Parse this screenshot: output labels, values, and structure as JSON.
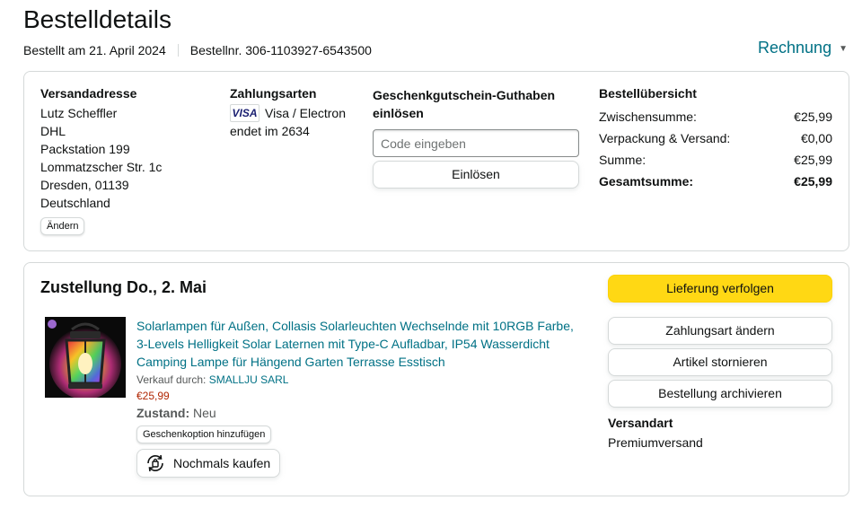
{
  "header": {
    "title": "Bestelldetails",
    "ordered_on": "Bestellt am 21. April 2024",
    "order_number": "Bestellnr. 306-1103927-6543500",
    "invoice_label": "Rechnung"
  },
  "address": {
    "title": "Versandadresse",
    "lines": [
      "Lutz Scheffler",
      "DHL",
      "Packstation 199",
      "Lommatzscher Str. 1c",
      "Dresden, 01139",
      "Deutschland"
    ],
    "change_label": "Ändern"
  },
  "payment": {
    "title": "Zahlungsarten",
    "card_logo": "VISA",
    "card_type": "Visa / Electron",
    "card_ending": "endet im 2634"
  },
  "gift_card": {
    "title": "Geschenkgutschein-Guthaben einlösen",
    "placeholder": "Code eingeben",
    "redeem_label": "Einlösen"
  },
  "summary": {
    "title": "Bestellübersicht",
    "rows": [
      {
        "label": "Zwischensumme:",
        "value": "€25,99"
      },
      {
        "label": "Verpackung & Versand:",
        "value": "€0,00"
      },
      {
        "label": "Summe:",
        "value": "€25,99"
      },
      {
        "label": "Gesamtsumme:",
        "value": "€25,99"
      }
    ]
  },
  "delivery": {
    "title": "Zustellung Do., 2. Mai",
    "product": {
      "title": "Solarlampen für Außen, Collasis Solarleuchten Wechselnde mit 10RGB Farbe, 3-Levels Helligkeit Solar Laternen mit Type-C Aufladbar, IP54 Wasserdicht Camping Lampe für Hängend Garten Terrasse Esstisch",
      "seller_prefix": "Verkauf durch:",
      "seller_name": "SMALLJU SARL",
      "price": "€25,99",
      "condition_label": "Zustand:",
      "condition_value": "Neu",
      "gift_option_label": "Geschenkoption hinzufügen",
      "rebuy_label": "Nochmals kaufen"
    },
    "actions": {
      "track": "Lieferung verfolgen",
      "change_payment": "Zahlungsart ändern",
      "cancel": "Artikel stornieren",
      "archive": "Bestellung archivieren"
    },
    "shipping_method_title": "Versandart",
    "shipping_method_value": "Premiumversand"
  },
  "colors": {
    "link": "#007185",
    "price": "#B12704",
    "primary_button": "#FFD814",
    "border": "#D5D9D9"
  }
}
